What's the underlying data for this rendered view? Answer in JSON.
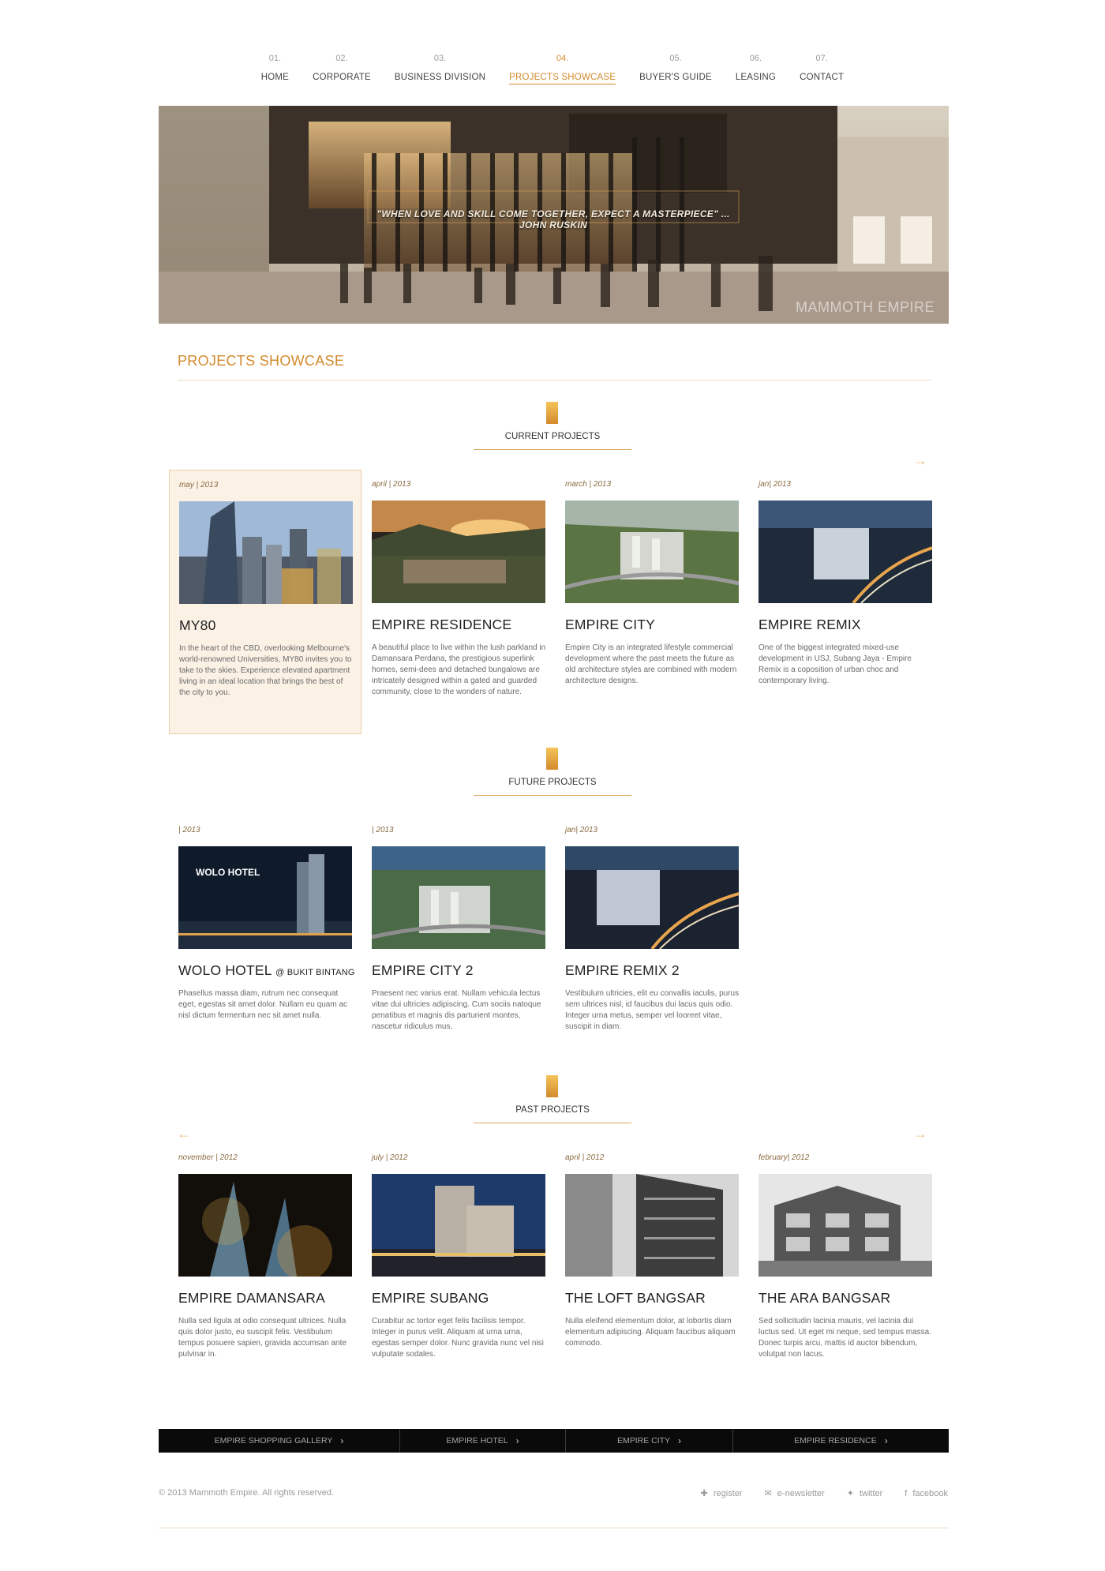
{
  "nav": [
    {
      "num": "01.",
      "label": "HOME",
      "active": false
    },
    {
      "num": "02.",
      "label": "CORPORATE",
      "active": false
    },
    {
      "num": "03.",
      "label": "BUSINESS DIVISION",
      "active": false
    },
    {
      "num": "04.",
      "label": "PROJECTS SHOWCASE",
      "active": true
    },
    {
      "num": "05.",
      "label": "BUYER'S GUIDE",
      "active": false
    },
    {
      "num": "06.",
      "label": "LEASING",
      "active": false
    },
    {
      "num": "07.",
      "label": "CONTACT",
      "active": false
    }
  ],
  "hero": {
    "quote": "\"WHEN LOVE AND SKILL COME TOGETHER, EXPECT A MASTERPIECE\" ... JOHN RUSKIN",
    "brand": "MAMMOTH EMPIRE"
  },
  "page_title": "PROJECTS SHOWCASE",
  "sections": {
    "current": {
      "label": "CURRENT PROJECTS",
      "arrow_next": "→",
      "cards": [
        {
          "date": "may | 2013",
          "title": "MY80",
          "title_suffix": "",
          "desc": "In the heart of the CBD, overlooking Melbourne's world-renowned Universities, MY80 invites you to take to the skies. Experience elevated apartment living in an ideal location that brings the best of the city to you."
        },
        {
          "date": "april | 2013",
          "title": "EMPIRE RESIDENCE",
          "title_suffix": "",
          "desc": "A beautiful place to live within the lush parkland in Damansara Perdana, the prestigious superlink homes, semi-dees and detached bungalows are intricately designed within a gated and guarded community, close to the wonders of nature."
        },
        {
          "date": "march | 2013",
          "title": "EMPIRE CITY",
          "title_suffix": "",
          "desc": "Empire City is an integrated lifestyle commercial development where the past meets the future as old architecture styles are combined with modern architecture designs."
        },
        {
          "date": "jan| 2013",
          "title": "EMPIRE REMIX",
          "title_suffix": "",
          "desc": "One of the biggest integrated mixed-use development in USJ, Subang Jaya - Empire Remix is a coposition of urban choc and contemporary living."
        }
      ]
    },
    "future": {
      "label": "FUTURE PROJECTS",
      "cards": [
        {
          "date": "| 2013",
          "title": "WOLO HOTEL",
          "title_suffix": "@ BUKIT BINTANG",
          "image_text": "WOLO HOTEL",
          "desc": "Phasellus massa diam, rutrum nec consequat eget, egestas sit amet dolor. Nullam eu quam ac nisl dictum fermentum nec sit amet nulla."
        },
        {
          "date": "| 2013",
          "title": "EMPIRE CITY 2",
          "title_suffix": "",
          "desc": "Praesent nec varius erat. Nullam vehicula lectus vitae dui ultricies adipiscing. Cum sociis natoque penatibus et magnis dis parturient montes, nascetur ridiculus mus."
        },
        {
          "date": "jan| 2013",
          "title": "EMPIRE REMIX 2",
          "title_suffix": "",
          "desc": "Vestibulum ultricies, elit eu convallis iaculis, purus sem ultrices nisl, id faucibus dui lacus quis odio. Integer urna metus, semper vel looreet vitae, suscipit in diam."
        }
      ]
    },
    "past": {
      "label": "PAST PROJECTS",
      "arrow_prev": "←",
      "arrow_next": "→",
      "cards": [
        {
          "date": "november | 2012",
          "title": "EMPIRE DAMANSARA",
          "title_suffix": "",
          "desc": "Nulla sed ligula at odio consequat ultrices. Nulla quis dolor justo, eu suscipit felis. Vestibulum tempus posuere sapien, gravida accumsan ante pulvinar in."
        },
        {
          "date": "july | 2012",
          "title": "EMPIRE SUBANG",
          "title_suffix": "",
          "desc": "Curabitur ac tortor eget felis facilisis tempor. Integer in purus velit. Aliquam at urna urna, egestas semper dolor. Nunc gravida nunc vel nisi vulputate sodales."
        },
        {
          "date": "april | 2012",
          "title": "THE LOFT BANGSAR",
          "title_suffix": "",
          "desc": "Nulla eleifend elementum dolor, at lobortis diam elementum adipiscing. Aliquam faucibus aliquam commodo."
        },
        {
          "date": "february| 2012",
          "title": "THE ARA BANGSAR",
          "title_suffix": "",
          "desc": "Sed sollicitudin lacinia mauris, vel lacinia dui luctus sed. Ut eget mi neque, sed tempus massa. Donec turpis arcu, mattis id auctor bibendum, volutpat non lacus."
        }
      ]
    }
  },
  "footer_bar": [
    {
      "label": "EMPIRE SHOPPING GALLERY",
      "chevron": "›"
    },
    {
      "label": "EMPIRE HOTEL",
      "chevron": "›"
    },
    {
      "label": "EMPIRE CITY",
      "chevron": "›"
    },
    {
      "label": "EMPIRE RESIDENCE",
      "chevron": "›"
    }
  ],
  "copyright": "© 2013 Mammoth Empire. All rights reserved.",
  "social": [
    {
      "icon": "plus-icon",
      "glyph": "✚",
      "label": "register"
    },
    {
      "icon": "envelope-icon",
      "glyph": "✉",
      "label": "e-newsletter"
    },
    {
      "icon": "twitter-bird-icon",
      "glyph": "✦",
      "label": "twitter"
    },
    {
      "icon": "facebook-icon",
      "glyph": "f",
      "label": "facebook"
    }
  ],
  "colors": {
    "accent": "#d38a2c",
    "highlight_bg": "#fbf1e5",
    "footer_bg": "#0a0a0a"
  }
}
